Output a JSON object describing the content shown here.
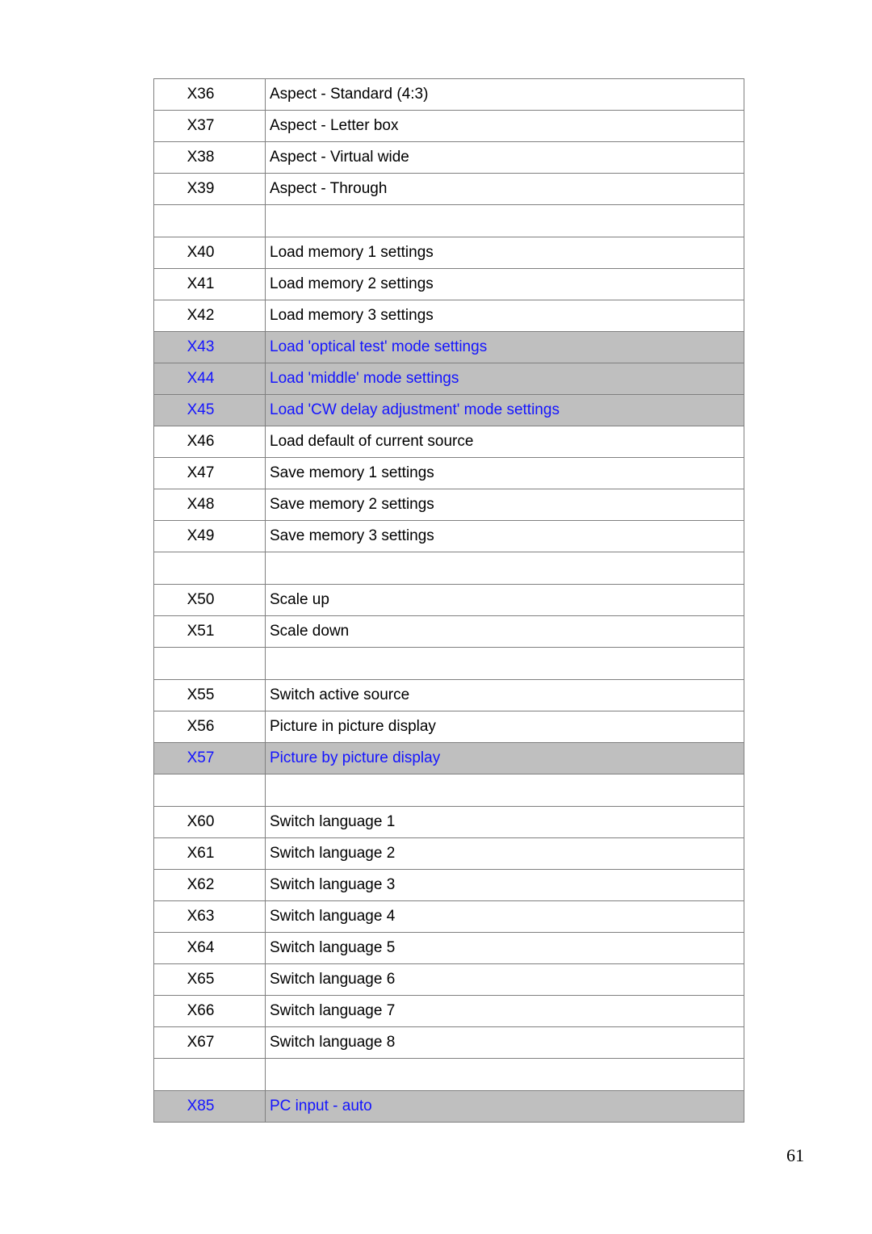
{
  "document": {
    "page_number": "61",
    "accent_highlight_color": "#bfbfbf",
    "accent_text_color": "#1414ff"
  },
  "table": {
    "rows": [
      {
        "id": "X36",
        "description": "Aspect - Standard (4:3)",
        "highlight": false,
        "spacer": false
      },
      {
        "id": "X37",
        "description": "Aspect - Letter box",
        "highlight": false,
        "spacer": false
      },
      {
        "id": "X38",
        "description": "Aspect - Virtual wide",
        "highlight": false,
        "spacer": false
      },
      {
        "id": "X39",
        "description": "Aspect - Through",
        "highlight": false,
        "spacer": false
      },
      {
        "id": "",
        "description": "",
        "highlight": false,
        "spacer": true
      },
      {
        "id": "X40",
        "description": "Load memory 1 settings",
        "highlight": false,
        "spacer": false
      },
      {
        "id": "X41",
        "description": "Load memory 2 settings",
        "highlight": false,
        "spacer": false
      },
      {
        "id": "X42",
        "description": "Load memory 3 settings",
        "highlight": false,
        "spacer": false
      },
      {
        "id": "X43",
        "description": "Load 'optical test' mode settings",
        "highlight": true,
        "spacer": false
      },
      {
        "id": "X44",
        "description": "Load 'middle' mode settings",
        "highlight": true,
        "spacer": false
      },
      {
        "id": "X45",
        "description": "Load 'CW delay adjustment' mode settings",
        "highlight": true,
        "spacer": false
      },
      {
        "id": "X46",
        "description": "Load default of current source",
        "highlight": false,
        "spacer": false
      },
      {
        "id": "X47",
        "description": "Save memory 1 settings",
        "highlight": false,
        "spacer": false
      },
      {
        "id": "X48",
        "description": "Save memory 2 settings",
        "highlight": false,
        "spacer": false
      },
      {
        "id": "X49",
        "description": "Save memory 3 settings",
        "highlight": false,
        "spacer": false
      },
      {
        "id": "",
        "description": "",
        "highlight": false,
        "spacer": true
      },
      {
        "id": "X50",
        "description": "Scale up",
        "highlight": false,
        "spacer": false
      },
      {
        "id": "X51",
        "description": "Scale down",
        "highlight": false,
        "spacer": false
      },
      {
        "id": "",
        "description": "",
        "highlight": false,
        "spacer": true
      },
      {
        "id": "X55",
        "description": "Switch active source",
        "highlight": false,
        "spacer": false
      },
      {
        "id": "X56",
        "description": "Picture in picture display",
        "highlight": false,
        "spacer": false
      },
      {
        "id": "X57",
        "description": "Picture by picture display",
        "highlight": true,
        "spacer": false
      },
      {
        "id": "",
        "description": "",
        "highlight": false,
        "spacer": true
      },
      {
        "id": "X60",
        "description": "Switch language 1",
        "highlight": false,
        "spacer": false
      },
      {
        "id": "X61",
        "description": "Switch language 2",
        "highlight": false,
        "spacer": false
      },
      {
        "id": "X62",
        "description": "Switch language 3",
        "highlight": false,
        "spacer": false
      },
      {
        "id": "X63",
        "description": "Switch language 4",
        "highlight": false,
        "spacer": false
      },
      {
        "id": "X64",
        "description": "Switch language 5",
        "highlight": false,
        "spacer": false
      },
      {
        "id": "X65",
        "description": "Switch language 6",
        "highlight": false,
        "spacer": false
      },
      {
        "id": "X66",
        "description": "Switch language 7",
        "highlight": false,
        "spacer": false
      },
      {
        "id": "X67",
        "description": "Switch language 8",
        "highlight": false,
        "spacer": false
      },
      {
        "id": "",
        "description": "",
        "highlight": false,
        "spacer": true
      },
      {
        "id": "X85",
        "description": "PC input - auto",
        "highlight": true,
        "spacer": false
      }
    ]
  }
}
